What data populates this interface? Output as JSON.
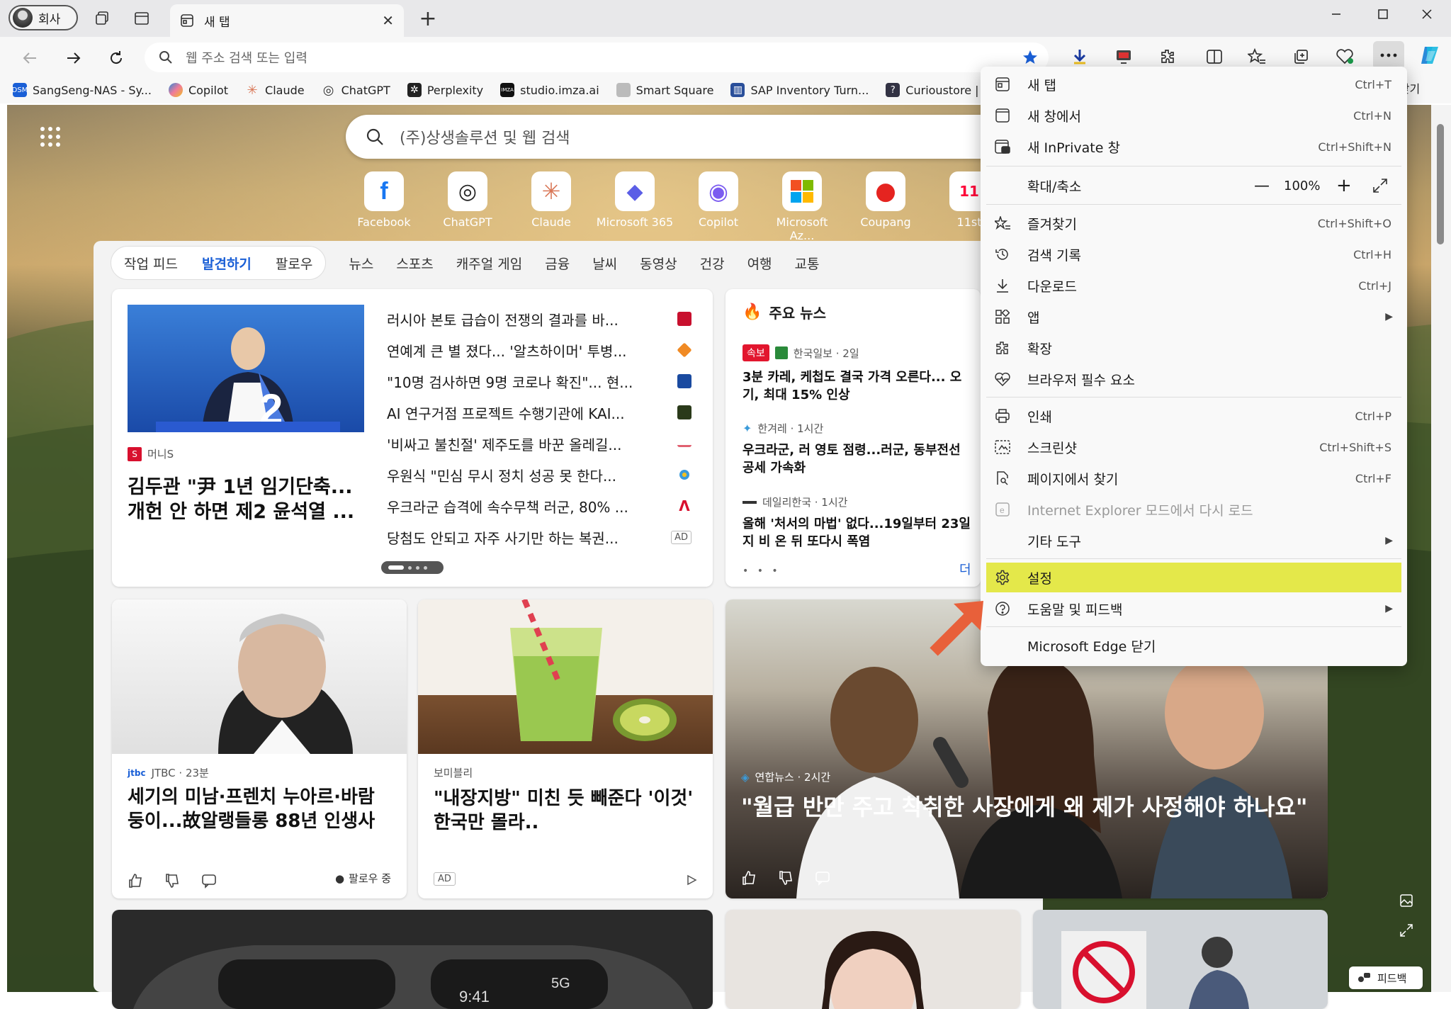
{
  "window": {
    "profile_label": "회사",
    "tab_title": "새 탭"
  },
  "toolbar": {
    "address_placeholder": "웹 주소 검색 또는 입력"
  },
  "favorites": [
    {
      "label": "SangSeng-NAS - Sy...",
      "color": "#1a5fd6",
      "icon": "DSM"
    },
    {
      "label": "Copilot",
      "color": "#7b5cf0",
      "icon": ""
    },
    {
      "label": "Claude",
      "color": "#d97757",
      "icon": "✳"
    },
    {
      "label": "ChatGPT",
      "color": "#333333",
      "icon": "◎"
    },
    {
      "label": "Perplexity",
      "color": "#222222",
      "icon": "✲"
    },
    {
      "label": "studio.imza.ai",
      "color": "#111111",
      "icon": "IMZA"
    },
    {
      "label": "Smart Square",
      "color": "#999999",
      "icon": ""
    },
    {
      "label": "SAP Inventory Turn...",
      "color": "#2a4f9a",
      "icon": "▥"
    },
    {
      "label": "Curioustore | Curiou",
      "color": "#333344",
      "icon": "?"
    }
  ],
  "favorites_right": "러찾기",
  "newtab": {
    "search_placeholder": "(주)상생솔루션 및 웹 검색",
    "shortcuts": [
      {
        "label": "Facebook",
        "icon": "f",
        "color": "#1877f2"
      },
      {
        "label": "ChatGPT",
        "icon": "◎",
        "color": "#222222"
      },
      {
        "label": "Claude",
        "icon": "✳",
        "color": "#d97757"
      },
      {
        "label": "Microsoft 365",
        "icon": "◆",
        "color": "#5b5ee6"
      },
      {
        "label": "Copilot",
        "icon": "◉",
        "color": "#7b5cf0"
      },
      {
        "label": "Microsoft Az...",
        "icon": "▦",
        "color": "#f25022"
      },
      {
        "label": "Coupang",
        "icon": "●",
        "color": "#e52420"
      },
      {
        "label": "11st",
        "icon": "11",
        "color": "#ff0038"
      }
    ],
    "pill_tabs": [
      "작업 피드",
      "발견하기",
      "팔로우"
    ],
    "tabs": [
      "뉴스",
      "스포츠",
      "캐주얼 게임",
      "금융",
      "날씨",
      "동영상",
      "건강",
      "여행",
      "교통"
    ]
  },
  "main_card": {
    "source": "머니S",
    "title_line1": "김두관 \"尹 1년 임기단축...",
    "title_line2": "개헌 안 하면 제2 윤석열 ...",
    "headlines": [
      {
        "text": "러시아 본토 급습이 전쟁의 결과를 바...",
        "badge": "#c8102e"
      },
      {
        "text": "연예계 큰 별 졌다... '알츠하이머' 투병...",
        "badge": "#f08a24"
      },
      {
        "text": "\"10명 검사하면 9명 코로나 확진\"... 현...",
        "badge": "#1a4aa0"
      },
      {
        "text": "AI 연구거점 프로젝트 수행기관에 KAI...",
        "badge": "#2a3a1a"
      },
      {
        "text": "'비싸고 불친절' 제주도를 바꾼 올레길...",
        "badge": "#e06070"
      },
      {
        "text": "우원식 \"민심 무시 정치 성공 못 한다...",
        "badge": "#3a9ad9"
      },
      {
        "text": "우크라군 습격에 속수무책 러군, 80% ...",
        "badge": "#d8102e"
      },
      {
        "text": "당첨도 안되고 자주 사기만 하는 복권...",
        "badge": ""
      }
    ],
    "ad_label": "AD"
  },
  "top_news": {
    "header": "주요 뉴스",
    "items": [
      {
        "tag": "속보",
        "source": "한국일보 · 2일",
        "text1": "3분 카레, 케첩도 결국 가격 오른다... 오",
        "text2": "기, 최대 15% 인상"
      },
      {
        "tag": "",
        "source": "한겨레 · 1시간",
        "text1": "우크라군, 러 영토 점령...러군, 동부전선",
        "text2": "공세 가속화"
      },
      {
        "tag": "",
        "source": "데일리한국 · 1시간",
        "text1": "올해 '처서의 마법' 없다...19일부터 23일",
        "text2": "지 비 온 뒤 또다시 폭염"
      }
    ],
    "more": "더"
  },
  "cards": [
    {
      "source": "JTBC · 23분",
      "title": "세기의 미남·프렌치 누아르·바람둥이...故알랭들롱 88년 인생사",
      "follow": "팔로우 중"
    },
    {
      "source": "보미블리",
      "title": "\"내장지방\" 미친 듯 빼준다 '이것' 한국만 몰라..",
      "ad": "AD"
    },
    {
      "source": "연합뉴스 · 2시간",
      "title": "\"월급 반만 주고 착취한 사장에게 왜 제가 사정해야 하나요\""
    }
  ],
  "menu": {
    "items": [
      {
        "label": "새 탭",
        "shortcut": "Ctrl+T"
      },
      {
        "label": "새 창에서",
        "shortcut": "Ctrl+N"
      },
      {
        "label": "새 InPrivate 창",
        "shortcut": "Ctrl+Shift+N"
      },
      {
        "label": "확대/축소",
        "zoom": "100%"
      },
      {
        "label": "즐겨찾기",
        "shortcut": "Ctrl+Shift+O"
      },
      {
        "label": "검색 기록",
        "shortcut": "Ctrl+H"
      },
      {
        "label": "다운로드",
        "shortcut": "Ctrl+J"
      },
      {
        "label": "앱"
      },
      {
        "label": "확장"
      },
      {
        "label": "브라우저 필수 요소"
      },
      {
        "label": "인쇄",
        "shortcut": "Ctrl+P"
      },
      {
        "label": "스크린샷",
        "shortcut": "Ctrl+Shift+S"
      },
      {
        "label": "페이지에서 찾기",
        "shortcut": "Ctrl+F"
      },
      {
        "label": "Internet Explorer 모드에서 다시 로드"
      },
      {
        "label": "기타 도구"
      },
      {
        "label": "설정"
      },
      {
        "label": "도움말 및 피드백"
      },
      {
        "label": "Microsoft Edge 닫기"
      }
    ],
    "highlight_color": "#e4e84a",
    "arrow_color": "#e8603a"
  },
  "feedback_label": "피드백"
}
